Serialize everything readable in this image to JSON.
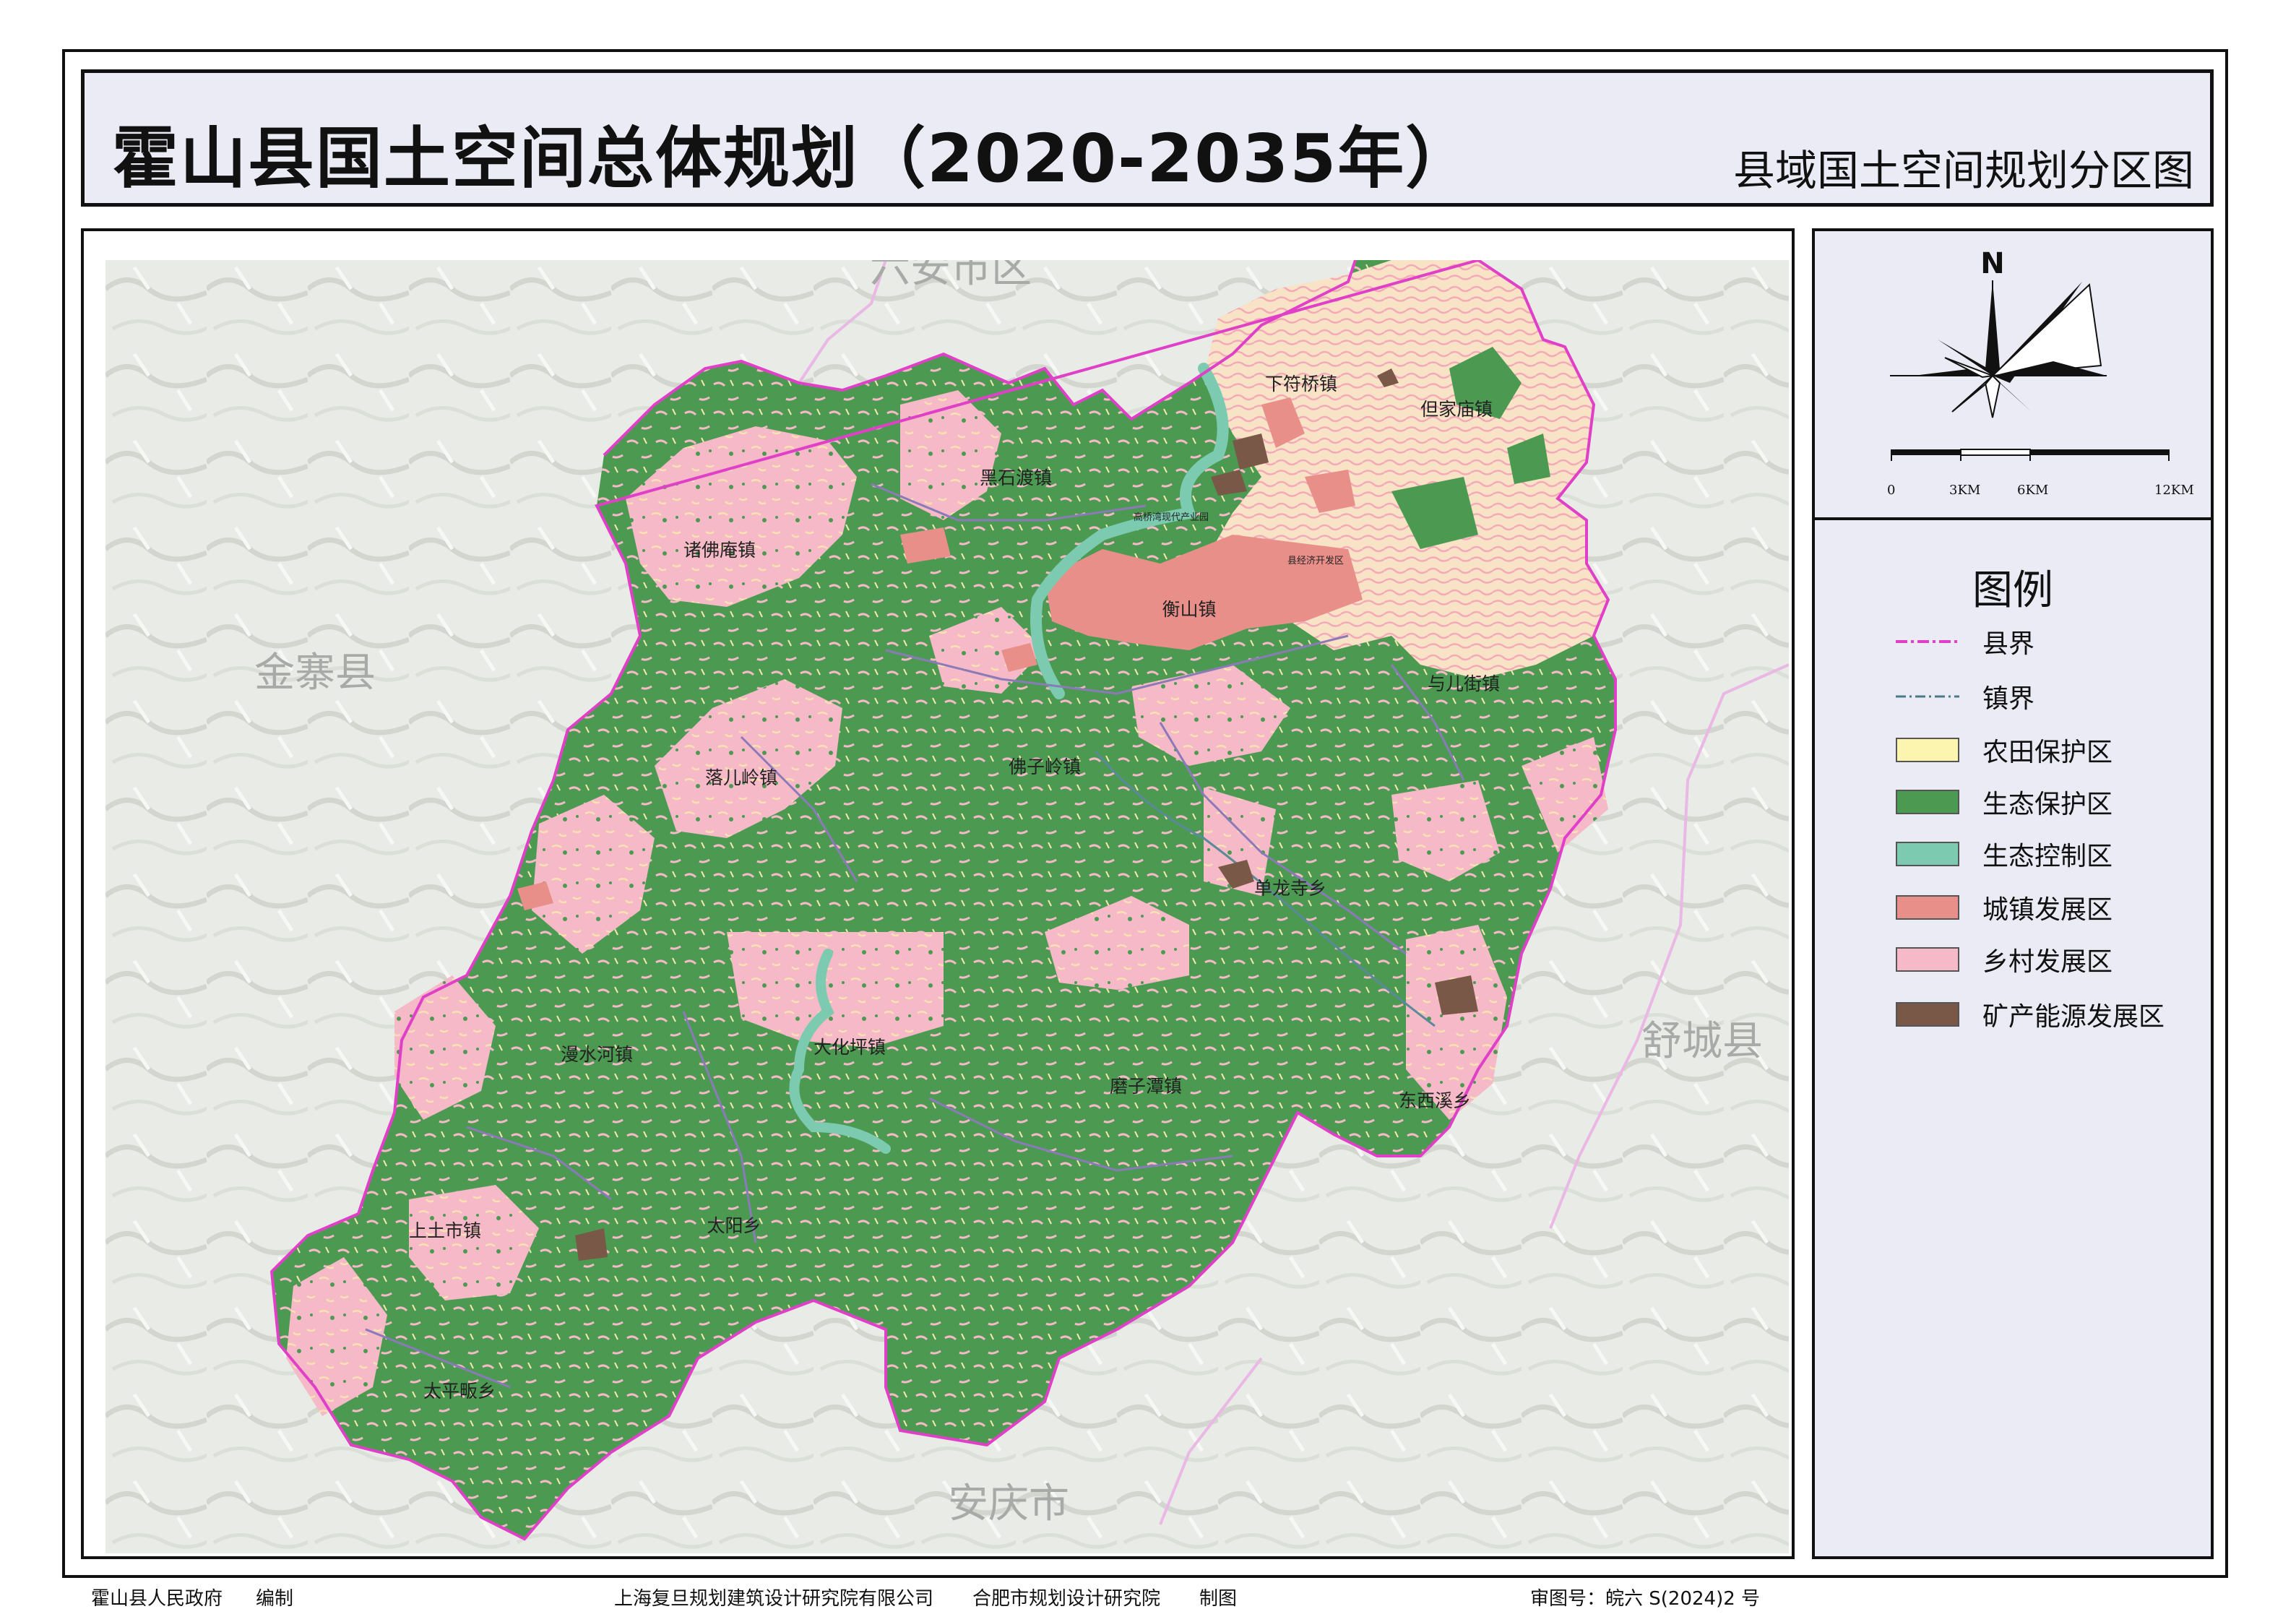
{
  "title": {
    "main": "霍山县国土空间总体规划（2020-2035年）",
    "subtitle": "县域国土空间规划分区图"
  },
  "map": {
    "neighbor_regions": {
      "north": "六安市区",
      "west": "金寨县",
      "east": "舒城县",
      "south": "安庆市"
    },
    "towns": [
      {
        "id": "xiafuqiao",
        "name": "下符桥镇"
      },
      {
        "id": "danjiamiao",
        "name": "但家庙镇"
      },
      {
        "id": "heishidu",
        "name": "黑石渡镇"
      },
      {
        "id": "zhufoan",
        "name": "诸佛庵镇"
      },
      {
        "id": "hengshan",
        "name": "衡山镇"
      },
      {
        "id": "yuerjie",
        "name": "与儿街镇"
      },
      {
        "id": "luoerling",
        "name": "落儿岭镇"
      },
      {
        "id": "foziling",
        "name": "佛子岭镇"
      },
      {
        "id": "danlongsi",
        "name": "单龙寺乡"
      },
      {
        "id": "manshuihe",
        "name": "漫水河镇"
      },
      {
        "id": "dahuaping",
        "name": "大化坪镇"
      },
      {
        "id": "mozitan",
        "name": "磨子潭镇"
      },
      {
        "id": "dongxixi",
        "name": "东西溪乡"
      },
      {
        "id": "shangtushi",
        "name": "上土市镇"
      },
      {
        "id": "taiyang",
        "name": "太阳乡"
      },
      {
        "id": "taipingchang",
        "name": "太平畈乡"
      }
    ],
    "parks": [
      {
        "id": "gaoqiao",
        "name": "高桥湾现代产业园"
      },
      {
        "id": "xianjingji",
        "name": "县经济开发区"
      }
    ]
  },
  "compass": {
    "north_label": "N"
  },
  "scale_bar": {
    "labels": [
      "0",
      "3KM",
      "6KM",
      "12KM"
    ]
  },
  "legend": {
    "title": "图例",
    "items": [
      {
        "id": "county-boundary",
        "label": "县界",
        "kind": "line",
        "color": "#e040c8"
      },
      {
        "id": "town-boundary",
        "label": "镇界",
        "kind": "line",
        "color": "#4a7a86"
      },
      {
        "id": "farmland",
        "label": "农田保护区",
        "kind": "fill",
        "color": "#fbf5b0"
      },
      {
        "id": "eco-protect",
        "label": "生态保护区",
        "kind": "fill",
        "color": "#4c9a52"
      },
      {
        "id": "eco-control",
        "label": "生态控制区",
        "kind": "fill",
        "color": "#7ccab0"
      },
      {
        "id": "urban",
        "label": "城镇发展区",
        "kind": "fill",
        "color": "#e98f8a"
      },
      {
        "id": "rural",
        "label": "乡村发展区",
        "kind": "fill",
        "color": "#f6b9c7"
      },
      {
        "id": "mining",
        "label": "矿产能源发展区",
        "kind": "fill",
        "color": "#7a5848"
      }
    ]
  },
  "footer": {
    "gov": "霍山县人民政府",
    "compile": "编制",
    "inst1": "上海复旦规划建筑设计研究院有限公司",
    "inst2": "合肥市规划设计研究院",
    "draw": "制图",
    "approval": "审图号：皖六 S(2024)2 号"
  }
}
